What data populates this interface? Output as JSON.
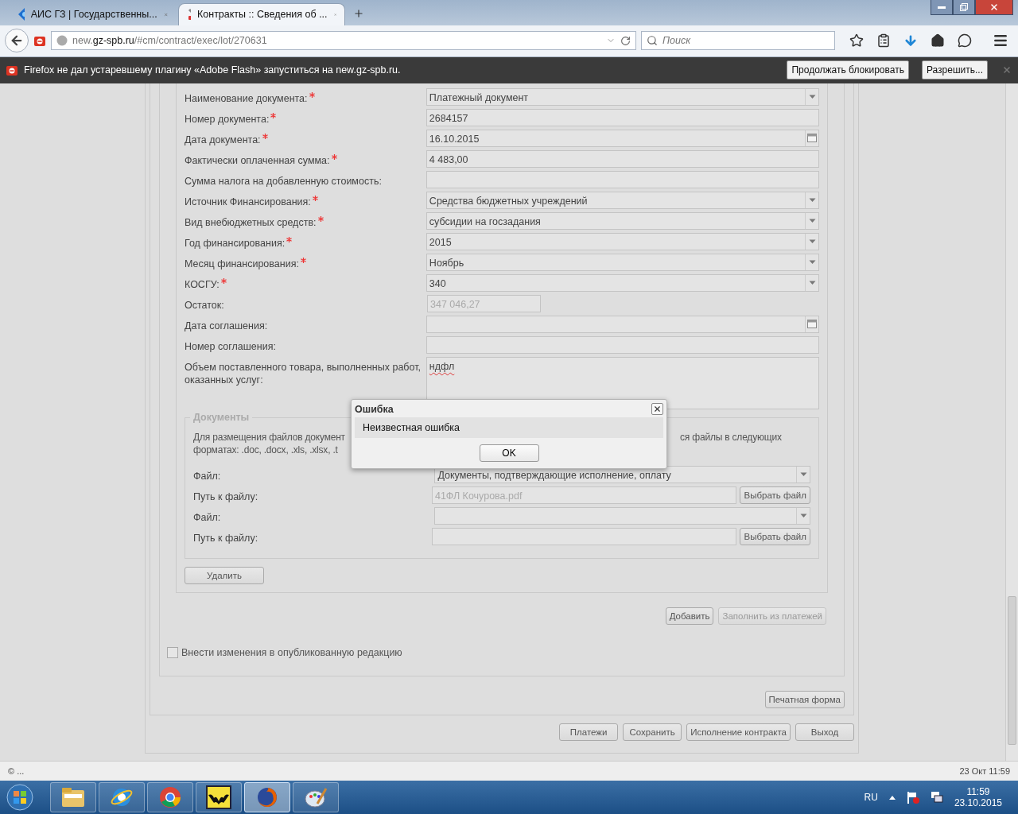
{
  "browser": {
    "tabs": [
      {
        "title": "АИС ГЗ | Государственны...",
        "selected": false,
        "kind": "site"
      },
      {
        "title": "Контракты :: Сведения об ...",
        "selected": true,
        "kind": "tools"
      }
    ],
    "url_host": "new.",
    "url_domain": "gz-spb.ru",
    "url_path": "/#cm/contract/exec/lot/270631",
    "search": {
      "placeholder": "Поиск"
    }
  },
  "notification": {
    "text": "Firefox не дал устаревшему плагину «Adobe Flash» запуститься на new.gz-spb.ru.",
    "buttons": [
      "Продолжать блокировать",
      "Разрешить..."
    ]
  },
  "form": {
    "fields": [
      {
        "label": "Наименование документа:",
        "required": true,
        "kind": "select",
        "value": "Платежный документ"
      },
      {
        "label": "Номер документа:",
        "required": true,
        "kind": "text",
        "value": "2684157"
      },
      {
        "label": "Дата документа:",
        "required": true,
        "kind": "date",
        "value": "16.10.2015"
      },
      {
        "label": "Фактически оплаченная сумма:",
        "required": true,
        "kind": "text",
        "value": "4 483,00"
      },
      {
        "label": "Сумма налога на добавленную стоимость:",
        "required": false,
        "kind": "text"
      },
      {
        "label": "Источник Финансирования:",
        "required": true,
        "kind": "select",
        "value": "Средства бюджетных учреждений"
      },
      {
        "label": "Вид внебюджетных средств:",
        "required": true,
        "kind": "select",
        "value": "субсидии на госзадания"
      },
      {
        "label": "Год финансирования:",
        "required": true,
        "kind": "select",
        "value": "2015"
      },
      {
        "label": "Месяц финансирования:",
        "required": true,
        "kind": "select",
        "value": "Ноябрь"
      },
      {
        "label": "КОСГУ:",
        "required": true,
        "kind": "select",
        "value": "340"
      },
      {
        "label": "Остаток:",
        "required": false,
        "kind": "readonly",
        "value": "347 046,27"
      },
      {
        "label": "Дата соглашения:",
        "required": false,
        "kind": "date"
      },
      {
        "label": "Номер соглашения:",
        "required": false,
        "kind": "text"
      },
      {
        "label": "Объем поставленного товара, выполненных работ, оказанных услуг:",
        "required": false,
        "kind": "textarea",
        "value": "ндфл"
      }
    ],
    "documents": {
      "legend": "Документы",
      "note_left": [
        "Для размещения файлов документ",
        "форматах: .doc, .docx, .xls, .xlsx, .t"
      ],
      "note_right": [
        "ся файлы в следующих"
      ],
      "files": [
        {
          "file_label": "Файл:",
          "file_value": "Документы, подтверждающие исполнение, оплату",
          "path_label": "Путь к файлу:",
          "path_value": "41ФЛ Кочурова.pdf",
          "button": "Выбрать файл"
        },
        {
          "file_label": "Файл:",
          "path_label": "Путь к файлу:",
          "button": "Выбрать файл"
        }
      ]
    },
    "delete_button": {
      "label": "Удалить",
      "disabled": false
    },
    "add_buttons": [
      {
        "label": "Добавить",
        "disabled": false
      },
      {
        "label": "Заполнить из платежей",
        "disabled": true
      }
    ],
    "publish_checkbox": {
      "label": "Внести изменения в опубликованную редакцию",
      "checked": false
    }
  },
  "print_button": "Печатная форма",
  "bottom_buttons": [
    "Платежи",
    "Сохранить",
    "Исполнение контракта",
    "Выход"
  ],
  "dialog": {
    "title": "Ошибка",
    "message": "Неизвестная ошибка",
    "button": "OK"
  },
  "status_bar": {
    "left": "© ...",
    "right": "23 Окт 11:59"
  },
  "taskbar": {
    "apps": [
      {
        "kind": "folder",
        "selected": false
      },
      {
        "kind": "ie",
        "selected": false
      },
      {
        "kind": "chrome",
        "selected": false
      },
      {
        "kind": "bat",
        "selected": false
      },
      {
        "kind": "firefox",
        "selected": true
      },
      {
        "kind": "paint",
        "selected": false
      }
    ],
    "language": "RU",
    "time": "11:59",
    "date": "23.10.2015"
  }
}
